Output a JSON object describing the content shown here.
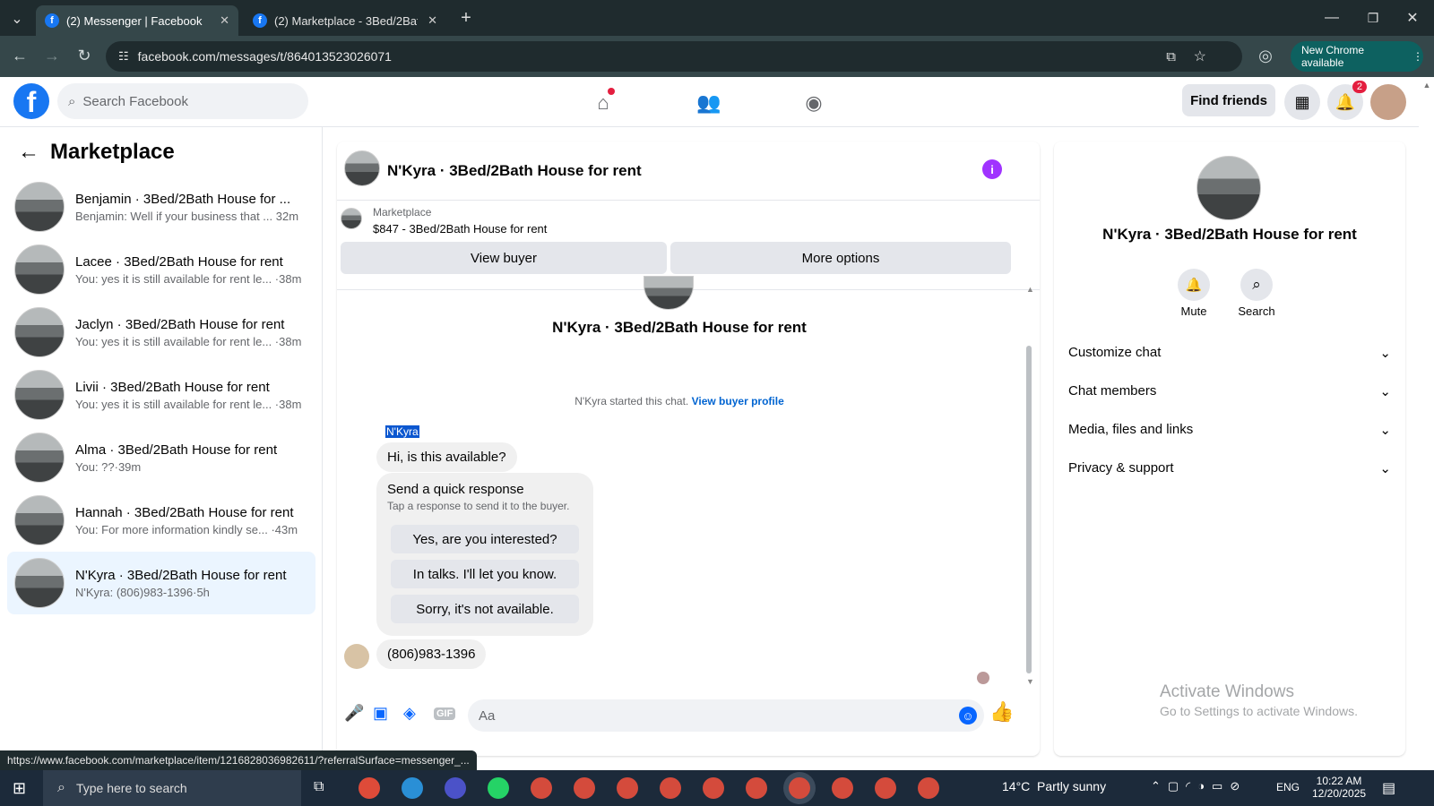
{
  "browser": {
    "tabs": [
      {
        "title": "(2) Messenger | Facebook",
        "active": true
      },
      {
        "title": "(2) Marketplace - 3Bed/2Bath H",
        "active": false
      }
    ],
    "url": "facebook.com/messages/t/864013523026071",
    "new_chrome_label": "New Chrome available",
    "status_url": "https://www.facebook.com/marketplace/item/1216828036982611/?referralSurface=messenger_..."
  },
  "header": {
    "search_placeholder": "Search Facebook",
    "find_friends": "Find friends",
    "notification_count": "2"
  },
  "marketplace": {
    "title": "Marketplace",
    "chats": [
      {
        "name": "Benjamin · 3Bed/2Bath House for ...",
        "preview": "Benjamin: Well if your business that ... 32m"
      },
      {
        "name": "Lacee · 3Bed/2Bath House for rent",
        "preview": "You: yes it is still available for rent le... ·38m"
      },
      {
        "name": "Jaclyn · 3Bed/2Bath House for rent",
        "preview": "You: yes it is still available for rent le... ·38m"
      },
      {
        "name": "Livii · 3Bed/2Bath House for rent",
        "preview": "You: yes it is still available for rent le... ·38m"
      },
      {
        "name": "Alma · 3Bed/2Bath House for rent",
        "preview": "You: ??·39m"
      },
      {
        "name": "Hannah · 3Bed/2Bath House for rent",
        "preview": "You: For more information kindly se... ·43m"
      },
      {
        "name": "N'Kyra · 3Bed/2Bath House for rent",
        "preview": "N'Kyra: (806)983-1396·5h"
      }
    ]
  },
  "chat": {
    "title": "N'Kyra · 3Bed/2Bath House for rent",
    "marketplace_label": "Marketplace",
    "listing": "$847 - 3Bed/2Bath House for rent",
    "view_buyer": "View buyer",
    "more_options": "More options",
    "intro_title": "N'Kyra · 3Bed/2Bath House for rent",
    "started_text": "N'Kyra started this chat.",
    "view_buyer_profile": "View buyer profile",
    "sender_name": "N'Kyra",
    "message1": "Hi, is this available?",
    "quick_title": "Send a quick response",
    "quick_sub": "Tap a response to send it to the buyer.",
    "quick_responses": [
      "Yes, are you interested?",
      "In talks. I'll let you know.",
      "Sorry, it's not available."
    ],
    "message2": "(806)983-1396",
    "composer_placeholder": "Aa"
  },
  "info_panel": {
    "title": "N'Kyra · 3Bed/2Bath House for rent",
    "mute": "Mute",
    "search": "Search",
    "sections": [
      "Customize chat",
      "Chat members",
      "Media, files and links",
      "Privacy & support"
    ]
  },
  "watermark": {
    "line1": "Activate Windows",
    "line2": "Go to Settings to activate Windows."
  },
  "taskbar": {
    "search_placeholder": "Type here to search",
    "weather": "14°C  Partly sunny",
    "lang": "ENG",
    "time": "10:22 AM",
    "date": "12/20/2025"
  },
  "colors": {
    "fb_blue": "#1877f2",
    "messenger_purple": "#a033ff",
    "link_blue": "#0064d1"
  }
}
